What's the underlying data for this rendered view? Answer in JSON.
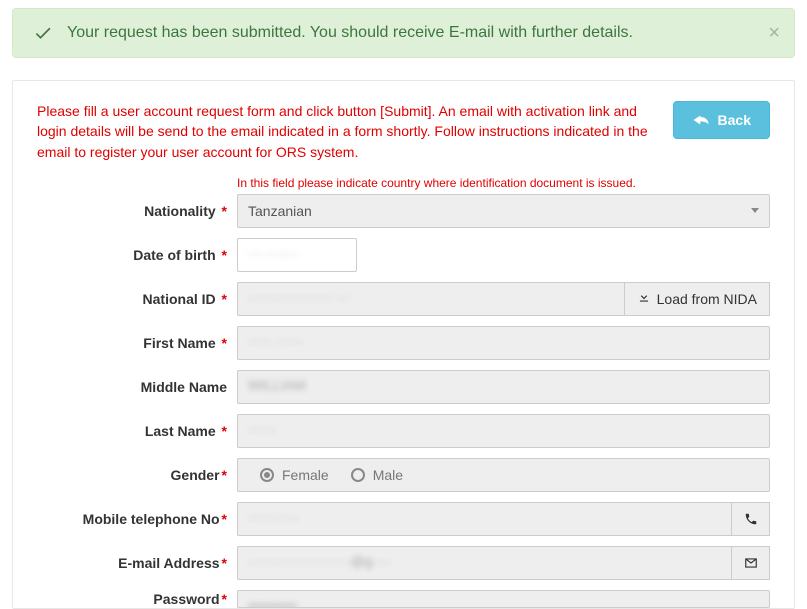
{
  "alert": {
    "message": "Your request has been submitted. You should receive E-mail with further details."
  },
  "instructions": "Please fill a user account request form and click button [Submit]. An email with activation link and login details will be send to the email indicated in a form shortly. Follow instructions indicated in the email to register your user account for ORS system.",
  "back_button": "Back",
  "nationality_help": "In this field please indicate country where identification document is issued.",
  "labels": {
    "nationality": "Nationality",
    "dob": "Date of birth",
    "national_id": "National ID",
    "first_name": "First Name",
    "middle_name": "Middle Name",
    "last_name": "Last Name",
    "gender": "Gender",
    "mobile": "Mobile telephone No",
    "email": "E-mail Address",
    "password": "Password"
  },
  "values": {
    "nationality": "Tanzanian",
    "dob": "··· ·······",
    "national_id": "·················· ···",
    "first_name": "····· ······",
    "middle_name": "WILLIAM",
    "last_name": "······",
    "mobile": "···········",
    "email": "······················@g····",
    "password": "••••••••••"
  },
  "gender": {
    "female": "Female",
    "male": "Male",
    "selected": "female"
  },
  "load_nida": "Load from NIDA"
}
